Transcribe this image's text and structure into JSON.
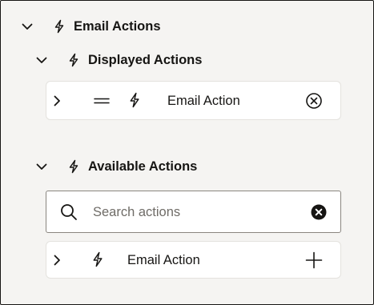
{
  "email_actions": {
    "title": "Email Actions",
    "expand_icon": "chevron-down-icon",
    "icon": "lightning-icon"
  },
  "displayed_actions": {
    "title": "Displayed Actions",
    "items": [
      {
        "label": "Email Action",
        "expand_icon": "chevron-right-icon",
        "drag_icon": "drag-handle-icon",
        "icon": "lightning-icon",
        "remove_icon": "remove-circle-icon"
      }
    ]
  },
  "available_actions": {
    "title": "Available Actions",
    "search": {
      "placeholder": "Search actions",
      "value": "",
      "clear_icon": "clear-icon"
    },
    "items": [
      {
        "label": "Email Action",
        "expand_icon": "chevron-right-icon",
        "icon": "lightning-icon",
        "add_icon": "plus-icon"
      }
    ]
  },
  "colors": {
    "background": "#f5f4f2",
    "card": "#ffffff",
    "text": "#161513",
    "placeholder": "#6f6c67"
  }
}
